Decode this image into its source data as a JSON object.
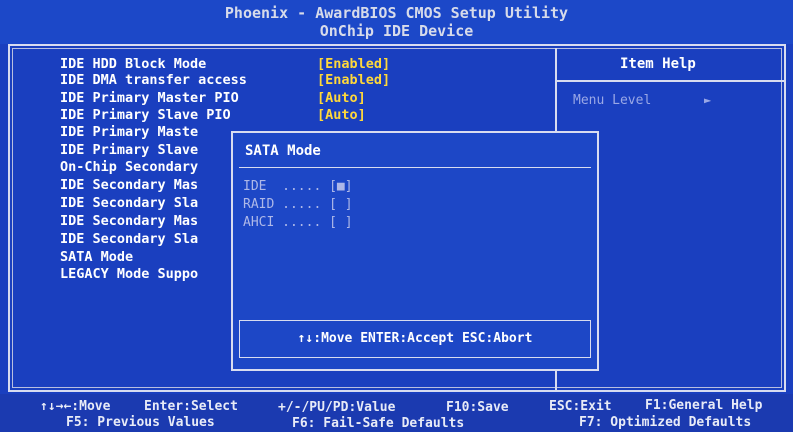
{
  "header": {
    "title": "Phoenix - AwardBIOS CMOS Setup Utility",
    "subtitle": "OnChip IDE Device"
  },
  "left_panel": {
    "items": [
      {
        "label": "IDE HDD Block Mode",
        "value": "[Enabled]"
      },
      {
        "label": "IDE DMA transfer access",
        "value": "[Enabled]"
      },
      {
        "label": "IDE Primary Master PIO",
        "value": "[Auto]"
      },
      {
        "label": "IDE Primary Slave  PIO",
        "value": "[Auto]"
      },
      {
        "label": "IDE Primary Maste",
        "value": ""
      },
      {
        "label": "IDE Primary Slave",
        "value": ""
      },
      {
        "label": "On-Chip Secondary",
        "value": ""
      },
      {
        "label": "IDE Secondary Mas",
        "value": ""
      },
      {
        "label": "IDE Secondary Sla",
        "value": ""
      },
      {
        "label": "IDE Secondary Mas",
        "value": ""
      },
      {
        "label": "IDE Secondary Sla",
        "value": ""
      },
      {
        "label": "SATA Mode",
        "value": ""
      },
      {
        "label": "LEGACY Mode Suppo",
        "value": ""
      }
    ]
  },
  "right_panel": {
    "title": "Item Help",
    "menu_level_label": "Menu Level",
    "menu_level_arrow": "►"
  },
  "popup": {
    "title": "SATA Mode",
    "options": [
      {
        "text": "IDE  ..... [■]",
        "selected": true
      },
      {
        "text": "RAID ..... [ ]",
        "selected": false
      },
      {
        "text": "AHCI ..... [ ]",
        "selected": false
      }
    ],
    "help": "↑↓:Move ENTER:Accept ESC:Abort"
  },
  "footer": {
    "move": "↑↓→←:Move",
    "enter": "Enter:Select",
    "value": "+/-/PU/PD:Value",
    "save": "F10:Save",
    "exit": "ESC:Exit",
    "help": "F1:General Help",
    "prev": "F5: Previous Values",
    "failsafe": "F6: Fail-Safe Defaults",
    "optimized": "F7: Optimized Defaults"
  }
}
